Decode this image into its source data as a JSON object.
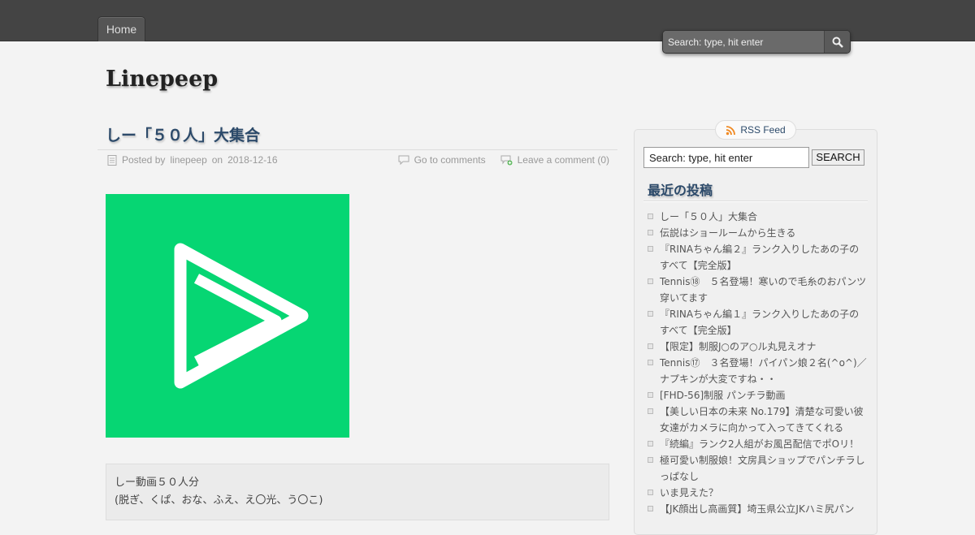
{
  "nav": {
    "home_label": "Home"
  },
  "top_search": {
    "placeholder": "Search: type, hit enter"
  },
  "site": {
    "title": "Linepeep"
  },
  "post": {
    "title": "しー「５０人」大集合",
    "meta": {
      "posted_by_prefix": "Posted by",
      "author": "linepeep",
      "on": "on",
      "date": "2018-12-16",
      "go_to_comments": "Go to comments",
      "leave_comment": "Leave a comment (0)"
    },
    "excerpt_lines": [
      "しー動画５０人分",
      "(脱ぎ、くぱ、おな、ふえ、え〇光、う〇こ)"
    ]
  },
  "sidebar": {
    "rss_label": "RSS Feed",
    "search_value": "Search: type, hit enter",
    "search_button": "SEARCH",
    "recent_title": "最近の投稿",
    "recent_posts": [
      "しー「５０人」大集合",
      "伝説はショールームから生きる",
      "『RINAちゃん編２』ランク入りしたあの子のすべて【完全版】",
      "Tennis⑱　５名登場！寒いので毛糸のおパンツ穿いてます",
      "『RINAちゃん編１』ランク入りしたあの子のすべて【完全版】",
      "【限定】制服J○のア○ル丸見えオナ",
      "Tennis⑰　３名登場！パイパン娘２名(^o^)／ナプキンが大変ですね・・",
      "[FHD-56]制服 パンチラ動画",
      "【美しい日本の未来 No.179】清楚な可愛い彼女達がカメラに向かって入ってきてくれる",
      "『続編』ランク2人組がお風呂配信でポOリ！",
      "極可愛い制服娘！文房具ショップでパンチラしっぱなし",
      "いま見えた？",
      "【JK顔出し高画質】埼玉県公立JKハミ尻パン"
    ]
  },
  "colors": {
    "topbar": "#444444",
    "accent_title": "#2c4a6a",
    "image_green": "#06d673"
  }
}
